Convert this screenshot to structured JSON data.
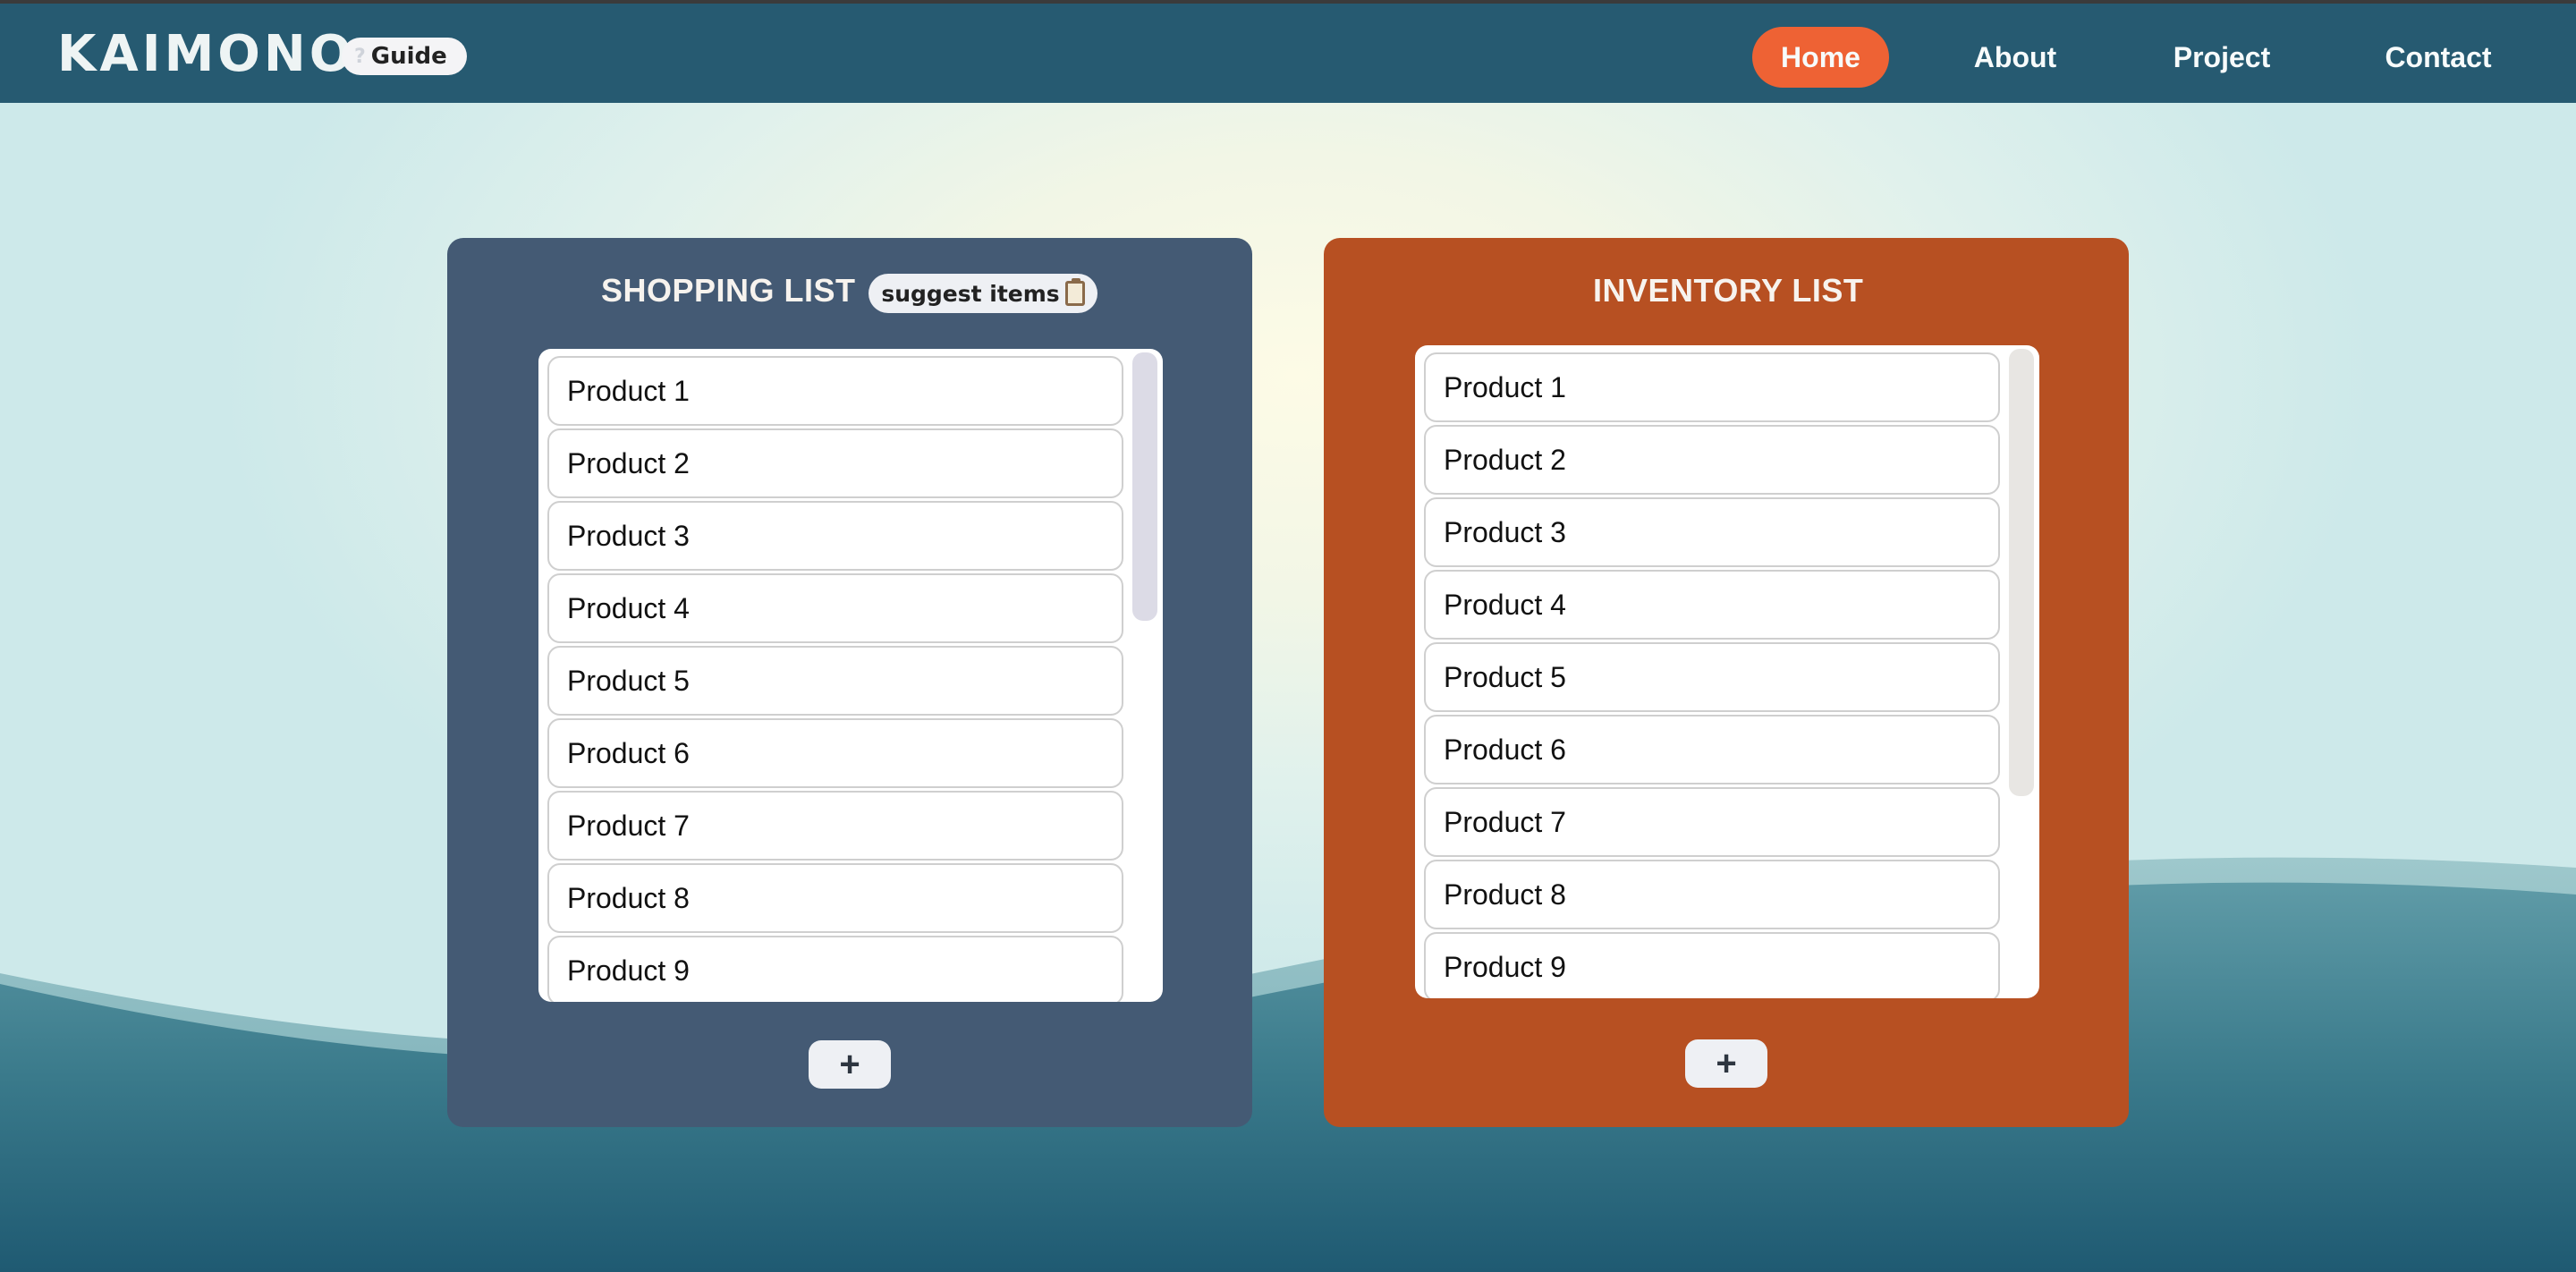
{
  "header": {
    "brand": "KAIMONO",
    "guide_icon": "?",
    "guide_label": "Guide",
    "nav": [
      {
        "label": "Home",
        "active": true
      },
      {
        "label": "About",
        "active": false
      },
      {
        "label": "Project",
        "active": false
      },
      {
        "label": "Contact",
        "active": false
      }
    ],
    "accent_color": "#ee6234",
    "bar_color": "#265a71"
  },
  "shopping_list": {
    "title": "SHOPPING LIST",
    "suggest_label": "suggest items",
    "suggest_icon": "clipboard-icon",
    "items": [
      "Product 1",
      "Product 2",
      "Product 3",
      "Product 4",
      "Product 5",
      "Product 6",
      "Product 7",
      "Product 8",
      "Product 9"
    ],
    "add_label": "+",
    "color": "#445a74"
  },
  "inventory_list": {
    "title": "INVENTORY LIST",
    "items": [
      "Product 1",
      "Product 2",
      "Product 3",
      "Product 4",
      "Product 5",
      "Product 6",
      "Product 7",
      "Product 8",
      "Product 9"
    ],
    "add_label": "+",
    "color": "#b75022"
  }
}
